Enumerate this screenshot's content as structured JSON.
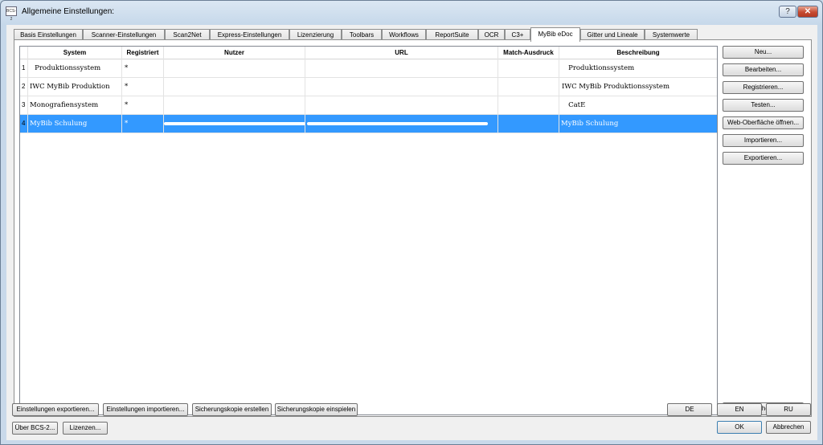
{
  "window": {
    "title": "Allgemeine Einstellungen:",
    "app_icon_text": "BCS-2",
    "help_glyph": "?",
    "close_glyph": "✕"
  },
  "tabs": [
    {
      "label": "Basis Einstellungen"
    },
    {
      "label": "Scanner-Einstellungen"
    },
    {
      "label": "Scan2Net"
    },
    {
      "label": "Express-Einstellungen"
    },
    {
      "label": "Lizenzierung"
    },
    {
      "label": "Toolbars"
    },
    {
      "label": "Workflows"
    },
    {
      "label": "ReportSuite"
    },
    {
      "label": "OCR"
    },
    {
      "label": "C3+"
    },
    {
      "label": "MyBib eDoc"
    },
    {
      "label": "Gitter und Lineale"
    },
    {
      "label": "Systemwerte"
    }
  ],
  "active_tab": "MyBib eDoc",
  "table": {
    "columns": [
      "System",
      "Registriert",
      "Nutzer",
      "URL",
      "Match-Ausdruck",
      "Beschreibung"
    ],
    "rows": [
      {
        "num": "1",
        "system": "   Produktionssystem",
        "registriert": "*",
        "nutzer": "",
        "url": "",
        "match": "",
        "beschreibung": "   Produktionssystem"
      },
      {
        "num": "2",
        "system": "IWC MyBib Produktion",
        "registriert": "*",
        "nutzer": "",
        "url": "",
        "match": "",
        "beschreibung": "IWC MyBib Produktionssystem"
      },
      {
        "num": "3",
        "system": "Monografiensystem",
        "registriert": "*",
        "nutzer": "",
        "url": "",
        "match": "",
        "beschreibung": "   CatE"
      },
      {
        "num": "4",
        "system": "MyBib Schulung",
        "registriert": "*",
        "nutzer": "",
        "url": "",
        "match": "",
        "beschreibung": "MyBib Schulung"
      }
    ]
  },
  "side_buttons": {
    "neu": "Neu...",
    "bearbeiten": "Bearbeiten...",
    "registrieren": "Registrieren...",
    "testen": "Testen...",
    "web": "Web-Oberfläche öffnen...",
    "importieren": "Importieren...",
    "exportieren": "Exportieren...",
    "loeschen": "Löschen..."
  },
  "bottom_buttons": {
    "export_settings": "Einstellungen exportieren...",
    "import_settings": "Einstellungen importieren...",
    "backup_create": "Sicherungskopie erstellen",
    "backup_restore": "Sicherungskopie einspielen",
    "about": "Über BCS-2...",
    "licenses": "Lizenzen...",
    "lang_de": "DE",
    "lang_en": "EN",
    "lang_ru": "RU",
    "ok": "OK",
    "cancel": "Abbrechen"
  }
}
